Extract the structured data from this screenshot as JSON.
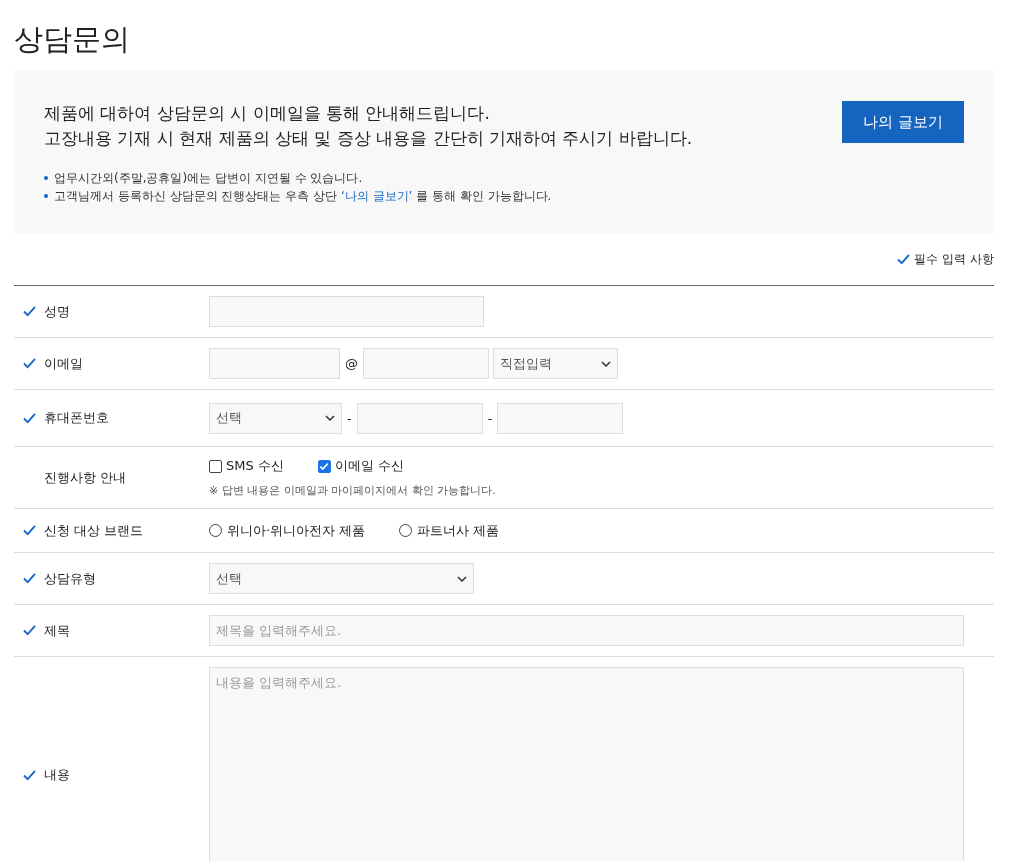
{
  "page_title": "상담문의",
  "notice": {
    "lines": [
      "제품에 대하여 상담문의 시 이메일을 통해 안내해드립니다.",
      "고장내용 기재 시 현재 제품의 상태 및 증상 내용을 간단히 기재하여 주시기 바랍니다."
    ],
    "button": "나의 글보기",
    "bullets": [
      {
        "before": "업무시간외(주말,공휴일)에는 답변이 지연될 수 있습니다."
      },
      {
        "before": "고객님께서 등록하신 상담문의 진행상태는 우측 상단 ",
        "link": "‘나의 글보기’",
        "after": " 를 통해 확인 가능합니다."
      }
    ]
  },
  "required_legend": "필수 입력 사항",
  "rows": [
    {
      "kind": "text",
      "label": "성명",
      "required": true
    },
    {
      "kind": "email",
      "label": "이메일",
      "required": true,
      "separator": "@",
      "domain_select": "직접입력"
    },
    {
      "kind": "phone",
      "label": "휴대폰번호",
      "required": true,
      "prefix_select": "선택",
      "separators": [
        "-",
        "-"
      ]
    },
    {
      "kind": "checkboxes",
      "label": "진행사항 안내",
      "required": false,
      "options": [
        {
          "label": "SMS 수신",
          "checked": false
        },
        {
          "label": "이메일 수신",
          "checked": true
        }
      ],
      "note": "※ 답변 내용은 이메일과 마이페이지에서 확인 가능합니다."
    },
    {
      "kind": "radios",
      "label": "신청 대상 브랜드",
      "required": true,
      "options": [
        {
          "label": "위니아·위니아전자 제품",
          "selected": false
        },
        {
          "label": "파트너사 제품",
          "selected": false
        }
      ]
    },
    {
      "kind": "select",
      "label": "상담유형",
      "required": true,
      "value": "선택"
    },
    {
      "kind": "title",
      "label": "제목",
      "required": true,
      "placeholder": "제목을 입력해주세요."
    },
    {
      "kind": "textarea",
      "label": "내용",
      "required": true,
      "placeholder": "내용을 입력해주세요."
    }
  ]
}
